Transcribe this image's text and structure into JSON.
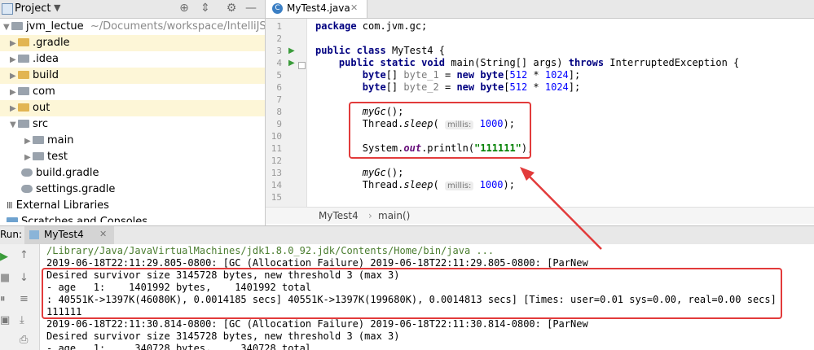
{
  "project": {
    "title": "Project",
    "tree": [
      {
        "label": "jvm_lectue",
        "suffix": "~/Documents/workspace/IntelliJSpac"
      },
      {
        "label": ".gradle"
      },
      {
        "label": ".idea"
      },
      {
        "label": "build"
      },
      {
        "label": "com"
      },
      {
        "label": "out"
      },
      {
        "label": "src"
      },
      {
        "label": "main"
      },
      {
        "label": "test"
      },
      {
        "label": "build.gradle"
      },
      {
        "label": "settings.gradle"
      },
      {
        "label": "External Libraries"
      },
      {
        "label": "Scratches and Consoles"
      }
    ]
  },
  "editor": {
    "tab_label": "MyTest4.java",
    "line_numbers": [
      "1",
      "2",
      "3",
      "4",
      "5",
      "6",
      "7",
      "8",
      "9",
      "10",
      "11",
      "12",
      "13",
      "14",
      "15"
    ],
    "code": {
      "l1_kw": "package",
      "l1_rest": " com.jvm.gc;",
      "l3_kw1": "public",
      "l3_kw2": "class",
      "l3_rest": " MyTest4 {",
      "l4_kw1": "public",
      "l4_kw2": "static",
      "l4_kw3": "void",
      "l4_mid": " main(String[] args) ",
      "l4_kw4": "throws",
      "l4_end": " InterruptedException {",
      "l5_kw1": "byte",
      "l5_arr": "[] ",
      "l5_var": "byte_1",
      "l5_eq": " = ",
      "l5_new": "new",
      "l5_sp": " ",
      "l5_kw2": "byte",
      "l5_ob": "[",
      "l5_n1": "512",
      "l5_mul": " * ",
      "l5_n2": "1024",
      "l5_end": "];",
      "l6_kw1": "byte",
      "l6_arr": "[] ",
      "l6_var": "byte_2",
      "l6_eq": " = ",
      "l6_new": "new",
      "l6_sp": " ",
      "l6_kw2": "byte",
      "l6_ob": "[",
      "l6_n1": "512",
      "l6_mul": " * ",
      "l6_n2": "1024",
      "l6_end": "];",
      "l8_call": "myGc",
      "l8_end": "();",
      "l9_cls": "Thread.",
      "l9_m": "sleep",
      "l9_op": "( ",
      "l9_hint": "millis:",
      "l9_sp": " ",
      "l9_num": "1000",
      "l9_end": ");",
      "l11_a": "System.",
      "l11_out": "out",
      "l11_b": ".println(",
      "l11_str": "\"111111\"",
      "l11_end": ");",
      "l13_call": "myGc",
      "l13_end": "();",
      "l14_cls": "Thread.",
      "l14_m": "sleep",
      "l14_op": "( ",
      "l14_hint": "millis:",
      "l14_sp": " ",
      "l14_num": "1000",
      "l14_end": ");"
    },
    "breadcrumb": [
      "MyTest4",
      "main()"
    ]
  },
  "run": {
    "label": "Run:",
    "tab_label": "MyTest4",
    "console": [
      "/Library/Java/JavaVirtualMachines/jdk1.8.0_92.jdk/Contents/Home/bin/java ...",
      "2019-06-18T22:11:29.805-0800: [GC (Allocation Failure) 2019-06-18T22:11:29.805-0800: [ParNew",
      "Desired survivor size 3145728 bytes, new threshold 3 (max 3)",
      "- age   1:    1401992 bytes,    1401992 total",
      ": 40551K->1397K(46080K), 0.0014185 secs] 40551K->1397K(199680K), 0.0014813 secs] [Times: user=0.01 sys=0.00, real=0.00 secs]",
      "111111",
      "2019-06-18T22:11:30.814-0800: [GC (Allocation Failure) 2019-06-18T22:11:30.814-0800: [ParNew",
      "Desired survivor size 3145728 bytes, new threshold 3 (max 3)",
      "- age   1:     340728 bytes,     340728 total"
    ]
  },
  "colors": {
    "annotation": "#e23b3b",
    "keyword": "#000080",
    "string": "#008000",
    "number": "#0000ff"
  }
}
